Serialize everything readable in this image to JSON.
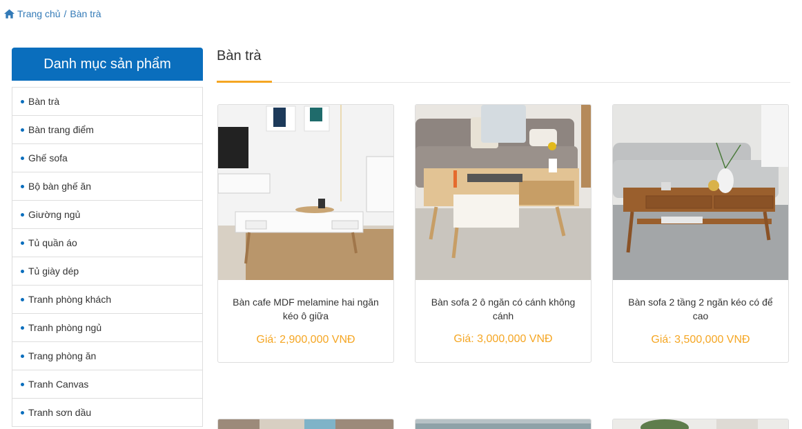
{
  "breadcrumb": {
    "home": "Trang chủ",
    "separator": "/",
    "current": "Bàn trà"
  },
  "sidebar": {
    "title": "Danh mục sản phẩm",
    "items": [
      {
        "label": "Bàn trà"
      },
      {
        "label": "Bàn trang điểm"
      },
      {
        "label": "Ghế sofa"
      },
      {
        "label": "Bộ bàn ghế ăn"
      },
      {
        "label": "Giường ngủ"
      },
      {
        "label": "Tủ quần áo"
      },
      {
        "label": "Tủ giày dép"
      },
      {
        "label": "Tranh phòng khách"
      },
      {
        "label": "Tranh phòng ngủ"
      },
      {
        "label": "Trang phòng ăn"
      },
      {
        "label": "Tranh Canvas"
      },
      {
        "label": "Tranh sơn dầu"
      }
    ]
  },
  "main": {
    "title": "Bàn trà",
    "products": [
      {
        "name": "Bàn cafe MDF melamine hai ngăn kéo ô giữa",
        "price": "Giá: 2,900,000 VNĐ"
      },
      {
        "name": "Bàn sofa 2 ô ngăn có cánh không cánh",
        "price": "Giá: 3,000,000 VNĐ"
      },
      {
        "name": "Bàn sofa 2 tầng 2 ngăn kéo có để cao",
        "price": "Giá: 3,500,000 VNĐ"
      }
    ]
  },
  "colors": {
    "brand_blue": "#0a6ebd",
    "link_blue": "#337ab7",
    "accent_orange": "#f5a623"
  }
}
